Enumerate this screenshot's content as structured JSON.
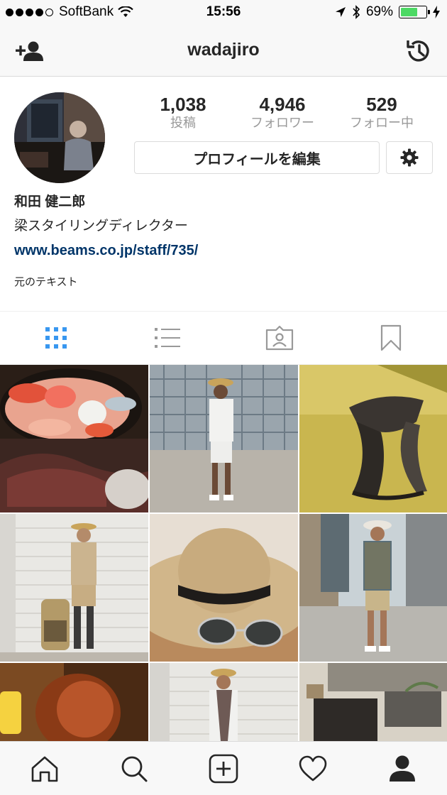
{
  "status_bar": {
    "carrier": "SoftBank",
    "time": "15:56",
    "battery_percent": "69%",
    "battery_level": 0.69,
    "signal_bars": 4,
    "icons": [
      "wifi-icon",
      "location-arrow-icon",
      "bluetooth-icon",
      "charging-bolt-icon"
    ]
  },
  "nav": {
    "title": "wadajiro",
    "left_icon": "add-person-icon",
    "right_icon": "history-icon"
  },
  "profile": {
    "stats": [
      {
        "value": "1,038",
        "label": "投稿"
      },
      {
        "value": "4,946",
        "label": "フォロワー"
      },
      {
        "value": "529",
        "label": "フォロー中"
      }
    ],
    "edit_button_label": "プロフィールを編集",
    "settings_icon": "gear-icon",
    "name": "和田 健二郎",
    "bio": "梁スタイリングディレクター",
    "link": "www.beams.co.jp/staff/735/",
    "note": "元のテキスト"
  },
  "tabs": [
    {
      "name": "grid-view",
      "icon": "grid-icon",
      "active": true
    },
    {
      "name": "list-view",
      "icon": "list-icon",
      "active": false
    },
    {
      "name": "tagged",
      "icon": "tagged-person-icon",
      "active": false
    },
    {
      "name": "saved",
      "icon": "bookmark-icon",
      "active": false
    }
  ],
  "bottom_bar": [
    {
      "name": "home",
      "icon": "home-icon"
    },
    {
      "name": "search",
      "icon": "search-icon"
    },
    {
      "name": "new-post",
      "icon": "add-post-icon"
    },
    {
      "name": "activity",
      "icon": "heart-icon"
    },
    {
      "name": "profile",
      "icon": "profile-icon",
      "active": true
    }
  ],
  "colors": {
    "accent_blue": "#3897f0",
    "link": "#003569",
    "battery_green": "#4cd964",
    "text": "#262626",
    "muted": "#999999"
  }
}
